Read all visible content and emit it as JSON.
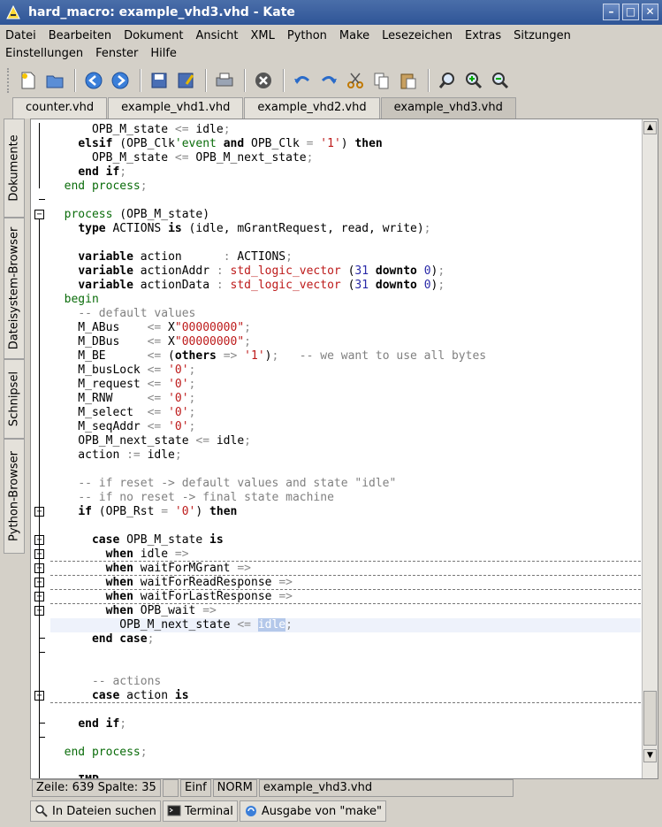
{
  "window": {
    "title": "hard_macro: example_vhd3.vhd - Kate"
  },
  "menu": [
    "Datei",
    "Bearbeiten",
    "Dokument",
    "Ansicht",
    "XML",
    "Python",
    "Make",
    "Lesezeichen",
    "Extras",
    "Sitzungen",
    "Einstellungen",
    "Fenster",
    "Hilfe"
  ],
  "toolbar": [
    "new-file-icon",
    "open-file-icon",
    "back-icon",
    "forward-icon",
    "save-icon",
    "save-as-icon",
    "print-icon",
    "close-icon",
    "undo-icon",
    "redo-icon",
    "cut-icon",
    "copy-icon",
    "paste-icon",
    "find-icon",
    "zoom-in-icon",
    "zoom-out-icon"
  ],
  "tabs": [
    "counter.vhd",
    "example_vhd1.vhd",
    "example_vhd2.vhd",
    "example_vhd3.vhd"
  ],
  "active_tab": "example_vhd3.vhd",
  "side_tabs": [
    "Dokumente",
    "Dateisystem-Browser",
    "Schnipsel",
    "Python-Browser"
  ],
  "status": {
    "position": "Zeile: 639 Spalte: 35",
    "mode": "Einf",
    "state": "NORM",
    "filename": "example_vhd3.vhd"
  },
  "bottom_tabs": [
    "In Dateien suchen",
    "Terminal",
    "Ausgabe von \"make\""
  ],
  "accent_color": "#2f5597"
}
